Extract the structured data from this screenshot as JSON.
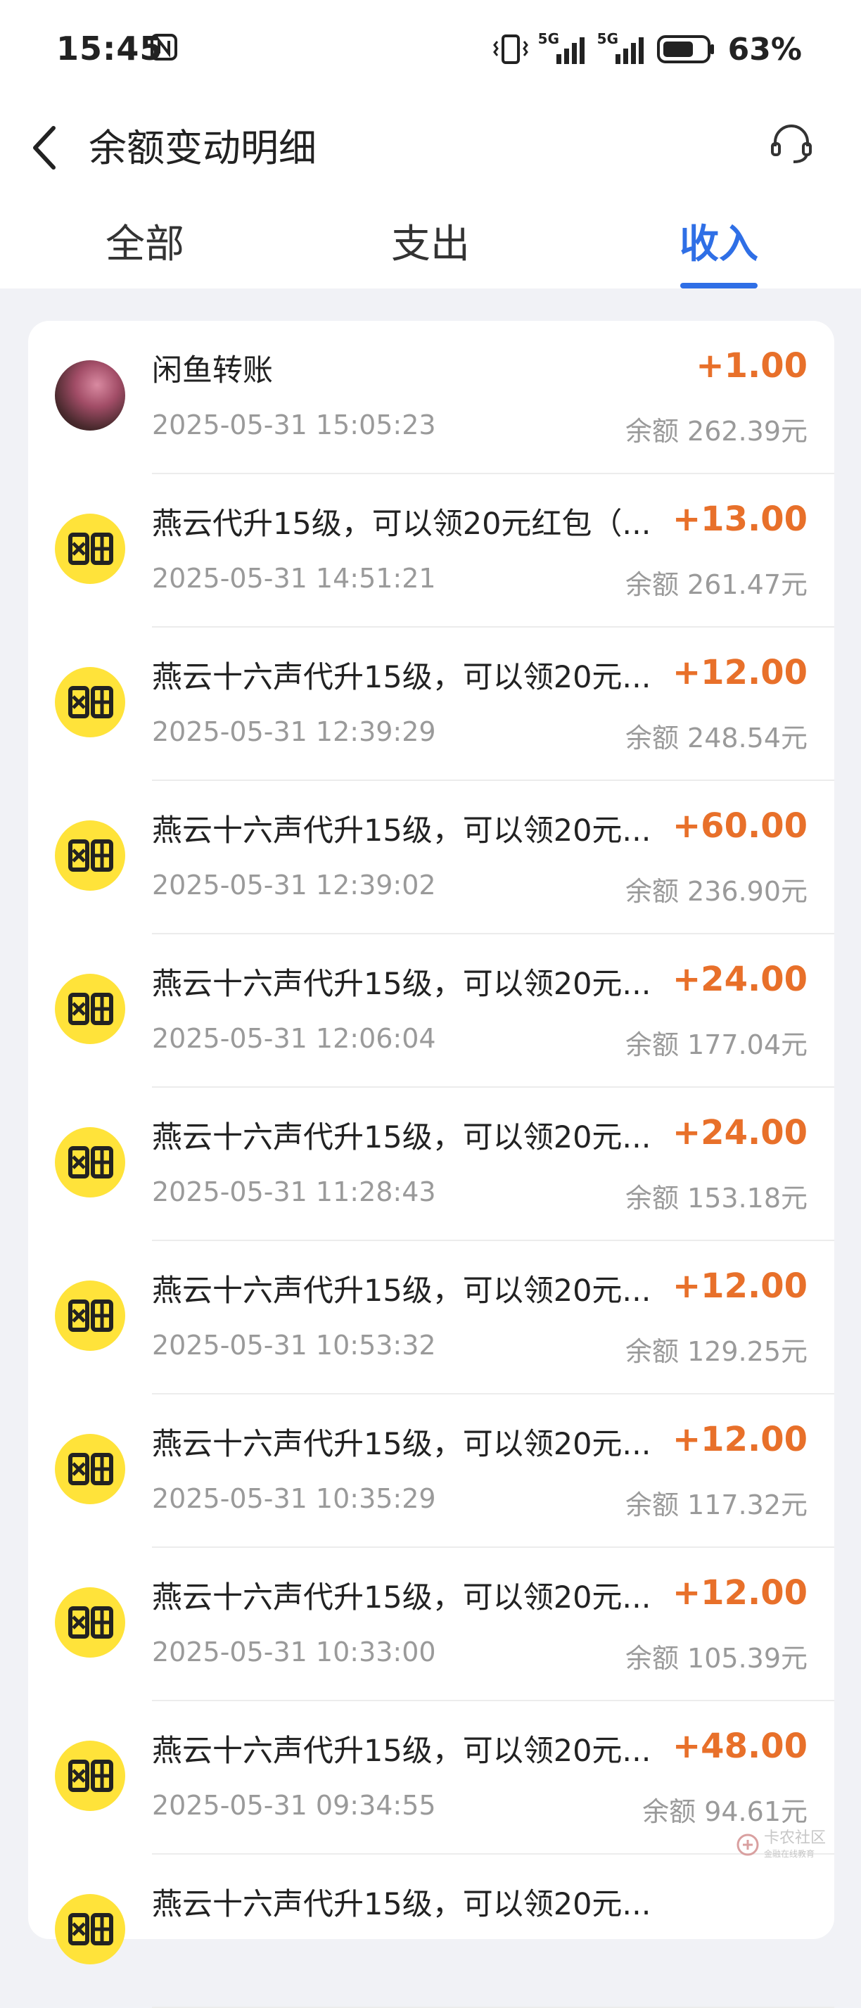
{
  "status": {
    "time": "15:45",
    "signal1": "5G",
    "signal2": "5G",
    "battery": "63%"
  },
  "header": {
    "title": "余额变动明细"
  },
  "tabs": [
    {
      "label": "全部",
      "active": false
    },
    {
      "label": "支出",
      "active": false
    },
    {
      "label": "收入",
      "active": true
    }
  ],
  "colors": {
    "accent": "#2f6fe6",
    "amount": "#e8702a",
    "avatar_yellow": "#ffe33a"
  },
  "transactions": [
    {
      "title": "闲鱼转账",
      "time": "2025-05-31 15:05:23",
      "amount": "+1.00",
      "balance": "余额 262.39元",
      "avatar": "photo-avatar"
    },
    {
      "title": "燕云代升15级，可以领20元红包（...",
      "time": "2025-05-31 14:51:21",
      "amount": "+13.00",
      "balance": "余额 261.47元",
      "avatar": "xianyu-logo"
    },
    {
      "title": "燕云十六声代升15级，可以领20元...",
      "time": "2025-05-31 12:39:29",
      "amount": "+12.00",
      "balance": "余额 248.54元",
      "avatar": "xianyu-logo"
    },
    {
      "title": "燕云十六声代升15级，可以领20元...",
      "time": "2025-05-31 12:39:02",
      "amount": "+60.00",
      "balance": "余额 236.90元",
      "avatar": "xianyu-logo"
    },
    {
      "title": "燕云十六声代升15级，可以领20元...",
      "time": "2025-05-31 12:06:04",
      "amount": "+24.00",
      "balance": "余额 177.04元",
      "avatar": "xianyu-logo"
    },
    {
      "title": "燕云十六声代升15级，可以领20元...",
      "time": "2025-05-31 11:28:43",
      "amount": "+24.00",
      "balance": "余额 153.18元",
      "avatar": "xianyu-logo"
    },
    {
      "title": "燕云十六声代升15级，可以领20元...",
      "time": "2025-05-31 10:53:32",
      "amount": "+12.00",
      "balance": "余额 129.25元",
      "avatar": "xianyu-logo"
    },
    {
      "title": "燕云十六声代升15级，可以领20元...",
      "time": "2025-05-31 10:35:29",
      "amount": "+12.00",
      "balance": "余额 117.32元",
      "avatar": "xianyu-logo"
    },
    {
      "title": "燕云十六声代升15级，可以领20元...",
      "time": "2025-05-31 10:33:00",
      "amount": "+12.00",
      "balance": "余额 105.39元",
      "avatar": "xianyu-logo"
    },
    {
      "title": "燕云十六声代升15级，可以领20元...",
      "time": "2025-05-31 09:34:55",
      "amount": "+48.00",
      "balance": "余额 94.61元",
      "avatar": "xianyu-logo"
    },
    {
      "title": "燕云十六声代升15级，可以领20元...",
      "time": "",
      "amount": "",
      "balance": "",
      "avatar": "xianyu-logo"
    }
  ],
  "watermark": {
    "text": "卡农社区",
    "sub": "金融在线教育"
  }
}
